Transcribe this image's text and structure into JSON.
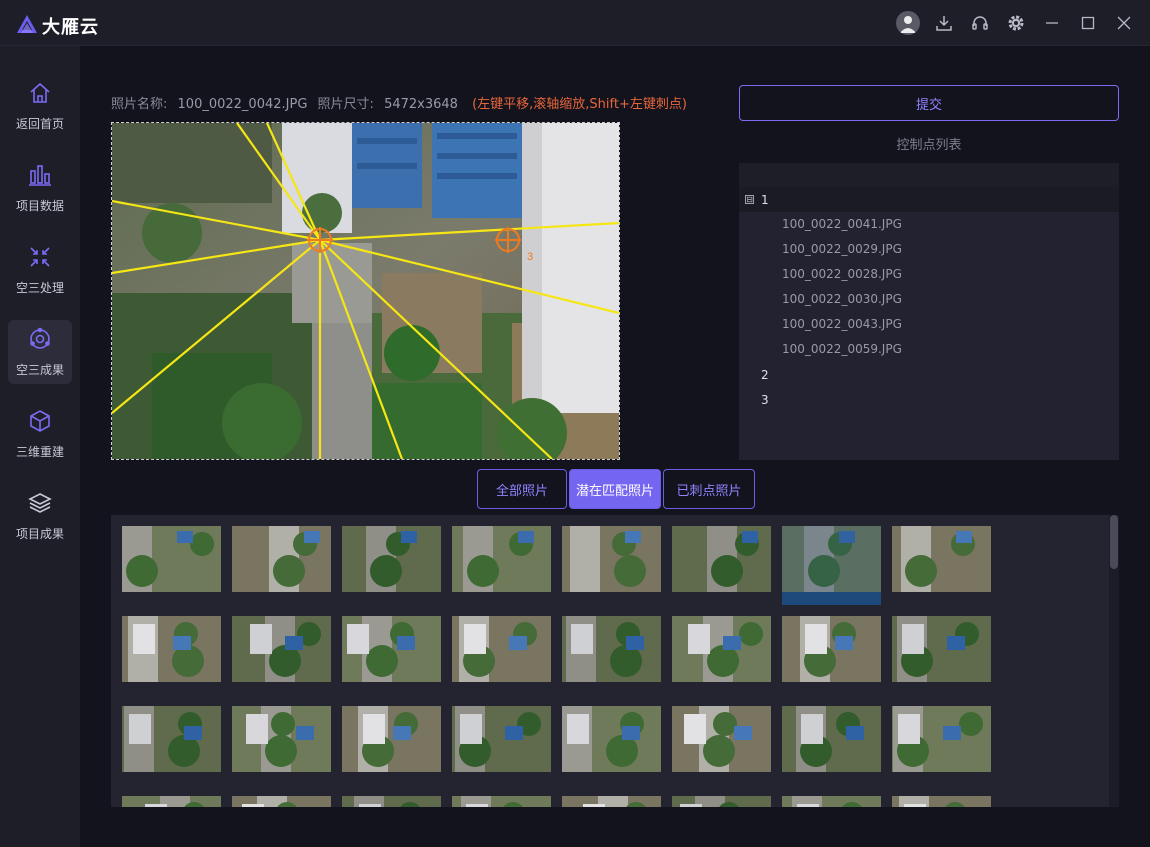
{
  "app": {
    "title": "大雁云"
  },
  "titlebar": {
    "icons": [
      "user-avatar-icon",
      "download-icon",
      "headset-icon",
      "gear-icon",
      "minimize-icon",
      "maximize-icon",
      "close-icon"
    ]
  },
  "sidebar": {
    "items": [
      {
        "label": "返回首页",
        "icon": "home-icon"
      },
      {
        "label": "项目数据",
        "icon": "bar-chart-icon"
      },
      {
        "label": "空三处理",
        "icon": "aerial-triangulation-icon"
      },
      {
        "label": "空三成果",
        "icon": "result-icon",
        "active": true
      },
      {
        "label": "三维重建",
        "icon": "cube-icon"
      },
      {
        "label": "项目成果",
        "icon": "layers-icon"
      }
    ]
  },
  "photo_info": {
    "name_label": "照片名称:",
    "name_value": "100_0022_0042.JPG",
    "size_label": "照片尺寸:",
    "size_value": "5472x3648",
    "hint": "(左键平移,滚轴缩放,Shift+左键刺点)"
  },
  "viewer": {
    "marker_labels": [
      "3"
    ]
  },
  "submit": {
    "label": "提交"
  },
  "control_points": {
    "title": "控制点列表",
    "groups": [
      {
        "id": "1",
        "expanded": true,
        "toggle": "⊟",
        "photos": [
          "100_0022_0041.JPG",
          "100_0022_0029.JPG",
          "100_0022_0028.JPG",
          "100_0022_0030.JPG",
          "100_0022_0043.JPG",
          "100_0022_0059.JPG"
        ]
      },
      {
        "id": "2",
        "expanded": false,
        "photos": []
      },
      {
        "id": "3",
        "expanded": false,
        "photos": []
      }
    ]
  },
  "tabs": [
    {
      "label": "全部照片",
      "active": false
    },
    {
      "label": "潜在匹配照片",
      "active": true
    },
    {
      "label": "已刺点照片",
      "active": false
    }
  ],
  "gallery": {
    "columns": 8,
    "rows_visible": 4,
    "selected_index": 6
  },
  "colors": {
    "accent": "#7466f0",
    "hint": "#e8663a",
    "marker": "#f07b1e",
    "epipolar_lines": "#f5e614"
  }
}
